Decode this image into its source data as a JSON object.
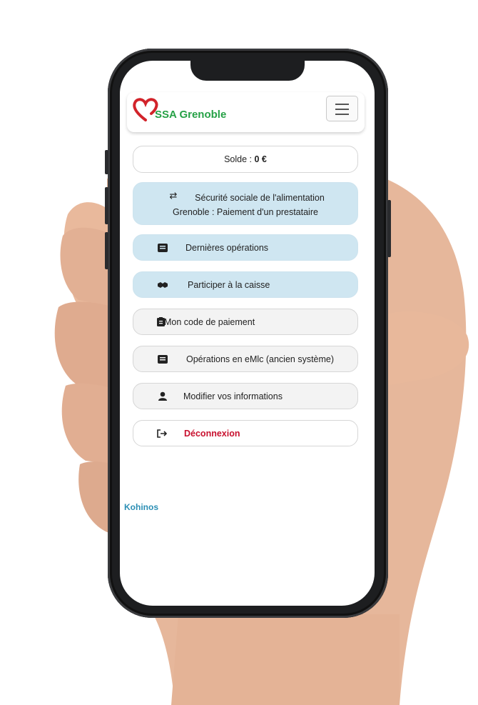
{
  "app": {
    "brand": "SSA Grenoble",
    "menu_icon": "hamburger-icon"
  },
  "balance": {
    "label": "Solde :",
    "value": "0 €"
  },
  "menu": [
    {
      "label": "Sécurité sociale de l'alimentation",
      "label2": "Grenoble : Paiement d'un prestataire",
      "icon": "transfer-arrows-icon"
    },
    {
      "label": "Dernières opérations",
      "icon": "list-icon"
    },
    {
      "label": "Participer à la caisse",
      "icon": "handshake-icon"
    },
    {
      "label": "Mon code de paiement",
      "icon": "clipboard-icon"
    },
    {
      "label": "Opérations en eMlc (ancien système)",
      "icon": "list-icon"
    },
    {
      "label": "Modifier vos informations",
      "icon": "user-icon"
    },
    {
      "label": "Déconnexion",
      "icon": "logout-icon"
    }
  ],
  "footer": {
    "brand": "Kohinos"
  },
  "colors": {
    "brand_green": "#26a146",
    "logo_red": "#d2232a",
    "button_blue": "#cfe6f1",
    "logout_red": "#c8102e",
    "footer_blue": "#2c8fb5"
  }
}
